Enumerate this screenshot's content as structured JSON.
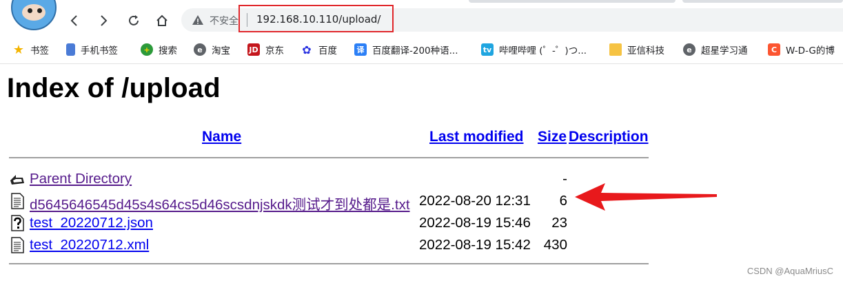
{
  "browser": {
    "security_label": "不安全",
    "url": "192.168.10.110/upload/"
  },
  "bookmarks": [
    {
      "label": "书签",
      "icon": "star-icon"
    },
    {
      "label": "手机书签",
      "icon": "phone-icon"
    },
    {
      "label": "搜索",
      "icon": "search-plus-icon"
    },
    {
      "label": "淘宝",
      "icon": "taobao-icon"
    },
    {
      "label": "京东",
      "icon": "jd-icon"
    },
    {
      "label": "百度",
      "icon": "baidu-icon"
    },
    {
      "label": "百度翻译-200种语...",
      "icon": "translate-icon"
    },
    {
      "label": "哔哩哔哩 (゜-゜)つ...",
      "icon": "bilibili-icon"
    },
    {
      "label": "亚信科技",
      "icon": "folder-icon"
    },
    {
      "label": "超星学习通",
      "icon": "chaoxing-icon"
    },
    {
      "label": "W-D-G的博",
      "icon": "csdn-icon"
    }
  ],
  "page": {
    "title": "Index of /upload",
    "columns": {
      "name": "Name",
      "last_modified": "Last modified",
      "size": "Size",
      "description": "Description"
    },
    "rows": [
      {
        "name": "Parent Directory",
        "date": "",
        "size": "-",
        "icon": "back-folder-icon"
      },
      {
        "name": "d5645646545d45s4s64cs5d46scsdnjskdk测试才到处都是.txt",
        "date": "2022-08-20 12:31",
        "size": "6",
        "icon": "text-file-icon"
      },
      {
        "name": "test_20220712.json",
        "date": "2022-08-19 15:46",
        "size": "23",
        "icon": "unknown-file-icon"
      },
      {
        "name": "test_20220712.xml",
        "date": "2022-08-19 15:42",
        "size": "430",
        "icon": "text-file-icon"
      }
    ]
  },
  "watermark": "CSDN @AquaMriusC",
  "colors": {
    "link": "#0000ee",
    "visited": "#551a8b",
    "highlight": "#e0262a"
  }
}
